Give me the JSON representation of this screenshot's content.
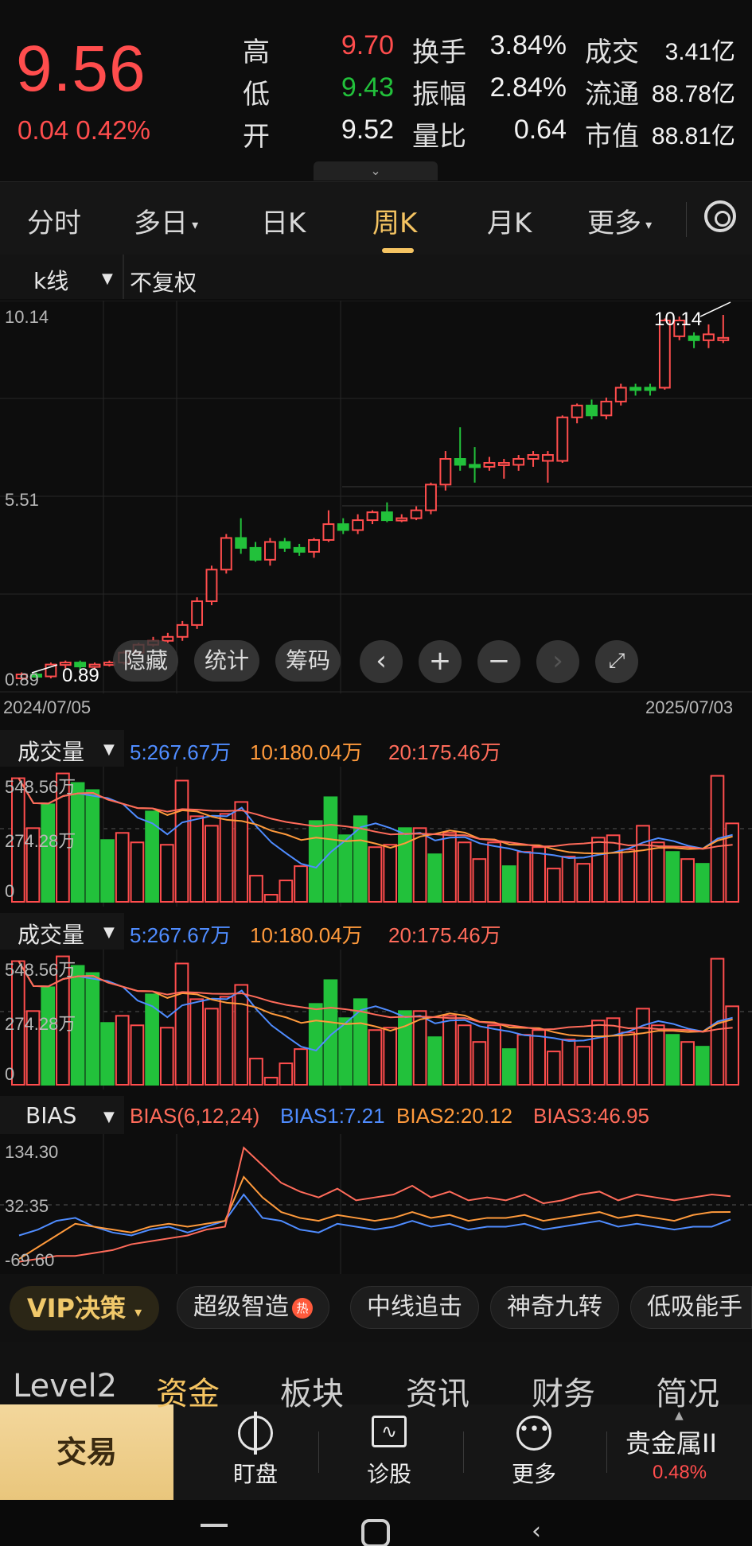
{
  "quote": {
    "price": "9.56",
    "change": "0.04",
    "change_pct": "0.42%",
    "rows": [
      {
        "l1": "高",
        "v1": "9.70",
        "c1": "red",
        "l2": "换手",
        "v2": "3.84%",
        "l3": "成交",
        "v3": "3.41亿"
      },
      {
        "l1": "低",
        "v1": "9.43",
        "c1": "green",
        "l2": "振幅",
        "v2": "2.84%",
        "l3": "流通",
        "v3": "88.78亿"
      },
      {
        "l1": "开",
        "v1": "9.52",
        "c1": "white",
        "l2": "量比",
        "v2": "0.64",
        "l3": "市值",
        "v3": "88.81亿"
      }
    ],
    "expand_icon": "chevron-down-icon"
  },
  "tabs": [
    "分时",
    "多日",
    "日K",
    "周K",
    "月K",
    "更多"
  ],
  "active_tab": "周K",
  "kline": {
    "selector": "k线",
    "adjust": "不复权",
    "y_labels": [
      "10.14",
      "5.51",
      "0.89"
    ],
    "max_label": "10.14",
    "min_label": "0.89",
    "date_start": "2024/07/05",
    "date_end": "2025/07/03",
    "tools": [
      "隐藏",
      "统计",
      "筹码"
    ]
  },
  "volume": {
    "selector": "成交量",
    "ma5": "5:267.67万",
    "ma10": "10:180.04万",
    "ma20": "20:175.46万",
    "y_labels": [
      "548.56万",
      "274.28万",
      "0"
    ]
  },
  "bias": {
    "selector": "BIAS",
    "params": "BIAS(6,12,24)",
    "b1": "BIAS1:7.21",
    "b2": "BIAS2:20.12",
    "b3": "BIAS3:46.95",
    "y_labels": [
      "134.30",
      "32.35",
      "-69.60"
    ]
  },
  "chips": {
    "vip": "VIP决策",
    "items": [
      "超级智造",
      "中线追击",
      "神奇九转",
      "低吸能手"
    ],
    "hot": "热"
  },
  "subnav": [
    "Level2",
    "资金",
    "板块",
    "资讯",
    "财务",
    "简况"
  ],
  "active_subnav": "资金",
  "bottom": {
    "trade": "交易",
    "items": [
      {
        "label": "盯盘",
        "icon": "target-icon"
      },
      {
        "label": "诊股",
        "icon": "pulse-chart-icon"
      },
      {
        "label": "更多",
        "icon": "more-dots-icon"
      }
    ],
    "ticker": {
      "name": "贵金属II",
      "pct": "0.48%"
    }
  },
  "colors": {
    "up": "#ff4d4d",
    "down": "#22c13b",
    "accent": "#f5c462",
    "ma5": "#4f8cff",
    "ma10": "#ff9a3c",
    "ma20": "#ff6b5a"
  },
  "chart_data": [
    {
      "type": "candlestick",
      "title": "周K",
      "x_range": [
        "2024/07/05",
        "2025/07/03"
      ],
      "y_range": [
        0.89,
        10.14
      ],
      "candles": [
        [
          0.95,
          1.05,
          0.89,
          1.1,
          1
        ],
        [
          1.05,
          1.0,
          0.95,
          1.1,
          0
        ],
        [
          1.0,
          1.3,
          0.95,
          1.35,
          1
        ],
        [
          1.3,
          1.35,
          1.2,
          1.4,
          1
        ],
        [
          1.35,
          1.25,
          1.15,
          1.4,
          0
        ],
        [
          1.25,
          1.3,
          1.2,
          1.35,
          1
        ],
        [
          1.3,
          1.35,
          1.25,
          1.4,
          1
        ],
        [
          1.35,
          1.6,
          1.3,
          1.65,
          1
        ],
        [
          1.6,
          1.8,
          1.55,
          1.85,
          1
        ],
        [
          1.8,
          1.9,
          1.75,
          2.0,
          1
        ],
        [
          1.9,
          2.0,
          1.85,
          2.1,
          1
        ],
        [
          2.0,
          2.3,
          1.9,
          2.4,
          1
        ],
        [
          2.3,
          2.9,
          2.2,
          3.0,
          1
        ],
        [
          2.9,
          3.7,
          2.8,
          3.8,
          1
        ],
        [
          3.7,
          4.5,
          3.6,
          4.6,
          1
        ],
        [
          4.5,
          4.25,
          4.1,
          5.0,
          0
        ],
        [
          4.25,
          3.95,
          3.9,
          4.4,
          0
        ],
        [
          3.95,
          4.4,
          3.8,
          4.5,
          1
        ],
        [
          4.4,
          4.25,
          4.15,
          4.5,
          0
        ],
        [
          4.25,
          4.15,
          4.05,
          4.35,
          0
        ],
        [
          4.15,
          4.45,
          4.0,
          4.5,
          1
        ],
        [
          4.45,
          4.85,
          4.4,
          5.2,
          1
        ],
        [
          4.85,
          4.7,
          4.6,
          5.0,
          0
        ],
        [
          4.7,
          4.95,
          4.6,
          5.1,
          1
        ],
        [
          4.95,
          5.15,
          4.85,
          5.2,
          1
        ],
        [
          5.15,
          4.95,
          4.9,
          5.4,
          0
        ],
        [
          4.95,
          5.0,
          4.9,
          5.1,
          1
        ],
        [
          5.0,
          5.2,
          4.95,
          5.3,
          1
        ],
        [
          5.2,
          5.85,
          5.1,
          5.9,
          1
        ],
        [
          5.85,
          6.5,
          5.7,
          6.7,
          1
        ],
        [
          6.5,
          6.35,
          6.2,
          7.3,
          0
        ],
        [
          6.35,
          6.3,
          5.9,
          6.8,
          0
        ],
        [
          6.3,
          6.4,
          6.2,
          6.55,
          1
        ],
        [
          6.4,
          6.35,
          6.0,
          6.5,
          1
        ],
        [
          6.35,
          6.5,
          6.2,
          6.6,
          1
        ],
        [
          6.5,
          6.6,
          6.3,
          6.7,
          1
        ],
        [
          6.6,
          6.45,
          5.9,
          6.7,
          1
        ],
        [
          6.45,
          7.55,
          6.4,
          7.6,
          1
        ],
        [
          7.55,
          7.85,
          7.4,
          7.9,
          1
        ],
        [
          7.85,
          7.6,
          7.5,
          8.0,
          0
        ],
        [
          7.6,
          7.95,
          7.5,
          8.05,
          1
        ],
        [
          7.95,
          8.3,
          7.85,
          8.4,
          1
        ],
        [
          8.3,
          8.25,
          8.1,
          8.4,
          0
        ],
        [
          8.25,
          8.3,
          8.1,
          8.4,
          0
        ],
        [
          8.3,
          10.0,
          8.25,
          10.05,
          1
        ],
        [
          10.0,
          9.6,
          9.5,
          10.1,
          1
        ],
        [
          9.6,
          9.5,
          9.3,
          9.7,
          0
        ],
        [
          9.5,
          9.65,
          9.3,
          9.9,
          1
        ],
        [
          9.52,
          9.56,
          9.43,
          10.14,
          1
        ]
      ]
    },
    {
      "type": "bar",
      "title": "成交量",
      "y_range": [
        0,
        548.56
      ],
      "unit": "万",
      "values": [
        520,
        310,
        410,
        540,
        500,
        470,
        260,
        290,
        250,
        380,
        240,
        510,
        360,
        320,
        370,
        420,
        110,
        30,
        90,
        150,
        340,
        440,
        280,
        360,
        230,
        240,
        310,
        310,
        200,
        290,
        250,
        180,
        250,
        150,
        210,
        230,
        140,
        190,
        160,
        270,
        280,
        220,
        320,
        250,
        210,
        180,
        160,
        530,
        330
      ],
      "up": [
        1,
        1,
        0,
        1,
        0,
        0,
        0,
        1,
        1,
        0,
        1,
        1,
        1,
        1,
        1,
        1,
        1,
        1,
        1,
        1,
        0,
        0,
        0,
        0,
        1,
        1,
        0,
        1,
        0,
        1,
        1,
        1,
        1,
        0,
        1,
        1,
        1,
        1,
        1,
        1,
        1,
        1,
        1,
        1,
        0,
        1,
        0,
        1,
        1
      ],
      "series": [
        {
          "name": "5",
          "latest": 267.67
        },
        {
          "name": "10",
          "latest": 180.04
        },
        {
          "name": "20",
          "latest": 175.46
        }
      ]
    },
    {
      "type": "line",
      "title": "BIAS(6,12,24)",
      "y_range": [
        -69.6,
        134.3
      ],
      "series": [
        {
          "name": "BIAS1",
          "latest": 7.21,
          "values": [
            -20,
            -10,
            5,
            10,
            -5,
            -15,
            -20,
            -10,
            -5,
            -15,
            -5,
            5,
            50,
            10,
            5,
            -10,
            -15,
            0,
            -5,
            -10,
            -5,
            5,
            -5,
            0,
            -10,
            -5,
            -5,
            0,
            -10,
            -5,
            0,
            5,
            -5,
            0,
            -5,
            -10,
            -5,
            -5,
            7.21
          ]
        },
        {
          "name": "BIAS2",
          "latest": 20.12,
          "values": [
            -60,
            -40,
            -20,
            0,
            -5,
            -10,
            -15,
            -5,
            0,
            -5,
            0,
            5,
            80,
            45,
            20,
            10,
            5,
            15,
            10,
            5,
            10,
            20,
            10,
            15,
            5,
            10,
            10,
            15,
            5,
            10,
            15,
            20,
            10,
            15,
            10,
            5,
            15,
            20,
            20.12
          ]
        },
        {
          "name": "BIAS3",
          "latest": 46.95,
          "values": [
            -65,
            -60,
            -55,
            -55,
            -50,
            -45,
            -35,
            -30,
            -25,
            -20,
            -10,
            -5,
            130,
            100,
            70,
            55,
            45,
            60,
            40,
            45,
            50,
            65,
            45,
            55,
            40,
            45,
            40,
            50,
            35,
            40,
            50,
            55,
            40,
            50,
            45,
            40,
            45,
            50,
            46.95
          ]
        }
      ]
    }
  ]
}
